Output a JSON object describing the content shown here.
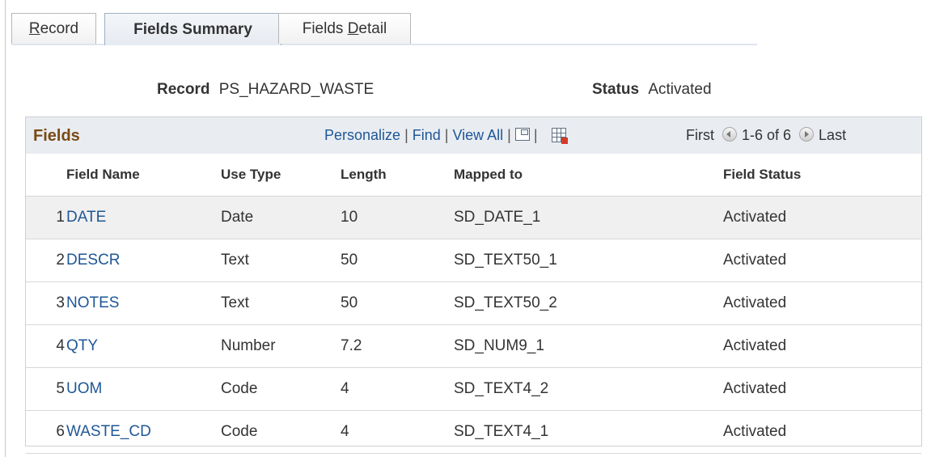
{
  "tabs": [
    {
      "label": "Record",
      "active": false
    },
    {
      "label": "Fields Summary",
      "active": true
    },
    {
      "label": "Fields Detail",
      "active": false
    }
  ],
  "header": {
    "record_label": "Record",
    "record_value": "PS_HAZARD_WASTE",
    "status_label": "Status",
    "status_value": "Activated"
  },
  "grid": {
    "title": "Fields",
    "nav": {
      "personalize": "Personalize",
      "find": "Find",
      "view_all": "View All"
    },
    "pager": {
      "first": "First",
      "range": "1-6 of 6",
      "last": "Last"
    },
    "columns": [
      "Field Name",
      "Use Type",
      "Length",
      "Mapped to",
      "Field Status"
    ],
    "rows": [
      {
        "num": "1",
        "field": "DATE",
        "use": "Date",
        "length": "10",
        "mapped": "SD_DATE_1",
        "status": "Activated"
      },
      {
        "num": "2",
        "field": "DESCR",
        "use": "Text",
        "length": "50",
        "mapped": "SD_TEXT50_1",
        "status": "Activated"
      },
      {
        "num": "3",
        "field": "NOTES",
        "use": "Text",
        "length": "50",
        "mapped": "SD_TEXT50_2",
        "status": "Activated"
      },
      {
        "num": "4",
        "field": "QTY",
        "use": "Number",
        "length": "7.2",
        "mapped": "SD_NUM9_1",
        "status": "Activated"
      },
      {
        "num": "5",
        "field": "UOM",
        "use": "Code",
        "length": "4",
        "mapped": "SD_TEXT4_2",
        "status": "Activated"
      },
      {
        "num": "6",
        "field": "WASTE_CD",
        "use": "Code",
        "length": "4",
        "mapped": "SD_TEXT4_1",
        "status": "Activated"
      }
    ]
  },
  "icons": [
    "zoom-grid-icon",
    "download-to-excel-icon",
    "previous-arrow-icon",
    "next-arrow-icon"
  ],
  "colors": {
    "link": "#1f5796",
    "grid_title": "#7a4a14",
    "header_bg": "#e9edf2",
    "alt_row": "#f0f0f0"
  }
}
